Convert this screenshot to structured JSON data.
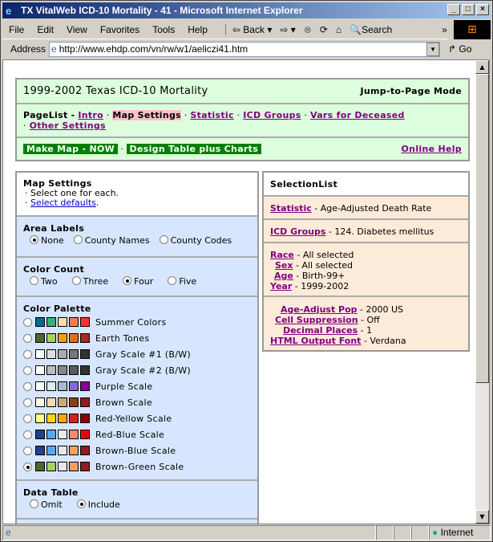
{
  "window": {
    "title": "TX VitalWeb ICD-10 Mortality - 41 - Microsoft Internet Explorer"
  },
  "menu": [
    "File",
    "Edit",
    "View",
    "Favorites",
    "Tools",
    "Help"
  ],
  "toolbar": {
    "back": "Back",
    "search": "Search",
    "more": "»"
  },
  "address": {
    "label": "Address",
    "url": "http://www.ehdp.com/vn/rw/w1/aeliczi41.htm",
    "go": "Go"
  },
  "status": {
    "zone": "Internet"
  },
  "header": {
    "title": "1999-2002 Texas ICD-10 Mortality",
    "mode": "Jump-to-Page Mode",
    "pagelist_label": "PageList -",
    "pages": [
      "Intro",
      "Map Settings",
      "Statistic",
      "ICD Groups",
      "Vars for Deceased",
      "Other Settings"
    ],
    "make_map": "Make Map - NOW",
    "design_table": "Design Table plus Charts",
    "help": "Online Help"
  },
  "map_settings": {
    "title": "Map Settings",
    "instruction": "· Select one for each.",
    "defaults_prefix": "·",
    "defaults_link": "Select defaults",
    "defaults_suffix": "."
  },
  "area_labels": {
    "title": "Area Labels",
    "options": [
      "None",
      "County Names",
      "County Codes"
    ],
    "selected": 0
  },
  "color_count": {
    "title": "Color Count",
    "options": [
      "Two",
      "Three",
      "Four",
      "Five"
    ],
    "selected": 2
  },
  "color_palette": {
    "title": "Color Palette",
    "selected": 9,
    "options": [
      {
        "label": "Summer Colors",
        "colors": [
          "#006c8c",
          "#33b37a",
          "#f0e0b0",
          "#ff7a50",
          "#ff3030"
        ]
      },
      {
        "label": "Earth Tones",
        "colors": [
          "#4d6a26",
          "#a8d060",
          "#f0a000",
          "#e07020",
          "#a82828"
        ]
      },
      {
        "label": "Gray Scale #1 (B/W)",
        "colors": [
          "#ffffff",
          "#dddddd",
          "#aaaaaa",
          "#777777",
          "#333333"
        ]
      },
      {
        "label": "Gray Scale #2 (B/W)",
        "colors": [
          "#ffffff",
          "#bbbbbb",
          "#888888",
          "#5a5a5a",
          "#333333"
        ]
      },
      {
        "label": "Purple Scale",
        "colors": [
          "#ffffff",
          "#d8f0ec",
          "#a8b8d0",
          "#8868d0",
          "#880090"
        ]
      },
      {
        "label": "Brown Scale",
        "colors": [
          "#fff8e8",
          "#f5dcb0",
          "#d0a878",
          "#8a4010",
          "#8a2020"
        ]
      },
      {
        "label": "Red-Yellow Scale",
        "colors": [
          "#ffff88",
          "#ffd800",
          "#ffa500",
          "#d82020",
          "#880000"
        ]
      },
      {
        "label": "Red-Blue Scale",
        "colors": [
          "#204090",
          "#58a8f0",
          "#e8e8e8",
          "#ff8868",
          "#ee0000"
        ]
      },
      {
        "label": "Brown-Blue Scale",
        "colors": [
          "#204090",
          "#58a8f0",
          "#e8e8e8",
          "#f5a060",
          "#8a2020"
        ]
      },
      {
        "label": "Brown-Green Scale",
        "colors": [
          "#4d6a26",
          "#a8d060",
          "#e8e8e8",
          "#f5a060",
          "#8a2020"
        ]
      }
    ]
  },
  "data_table": {
    "title": "Data Table",
    "options": [
      "Omit",
      "Include"
    ],
    "selected": 1
  },
  "selection": {
    "title": "SelectionList",
    "statistic": {
      "label": "Statistic",
      "value": "- Age-Adjusted Death Rate"
    },
    "icd": {
      "label": "ICD Groups",
      "value": "- 124. Diabetes mellitus"
    },
    "vars": [
      {
        "label": "Race",
        "value": "- All selected"
      },
      {
        "label": "Sex",
        "value": "- All selected"
      },
      {
        "label": "Age",
        "value": "- Birth-99+"
      },
      {
        "label": "Year",
        "value": "- 1999-2002"
      }
    ],
    "other": [
      {
        "label": "Age-Adjust Pop",
        "value": "- 2000 US"
      },
      {
        "label": "Cell Suppression",
        "value": "- Off"
      },
      {
        "label": "Decimal Places",
        "value": "- 1"
      },
      {
        "label": "HTML Output Font",
        "value": "- Verdana"
      }
    ]
  }
}
